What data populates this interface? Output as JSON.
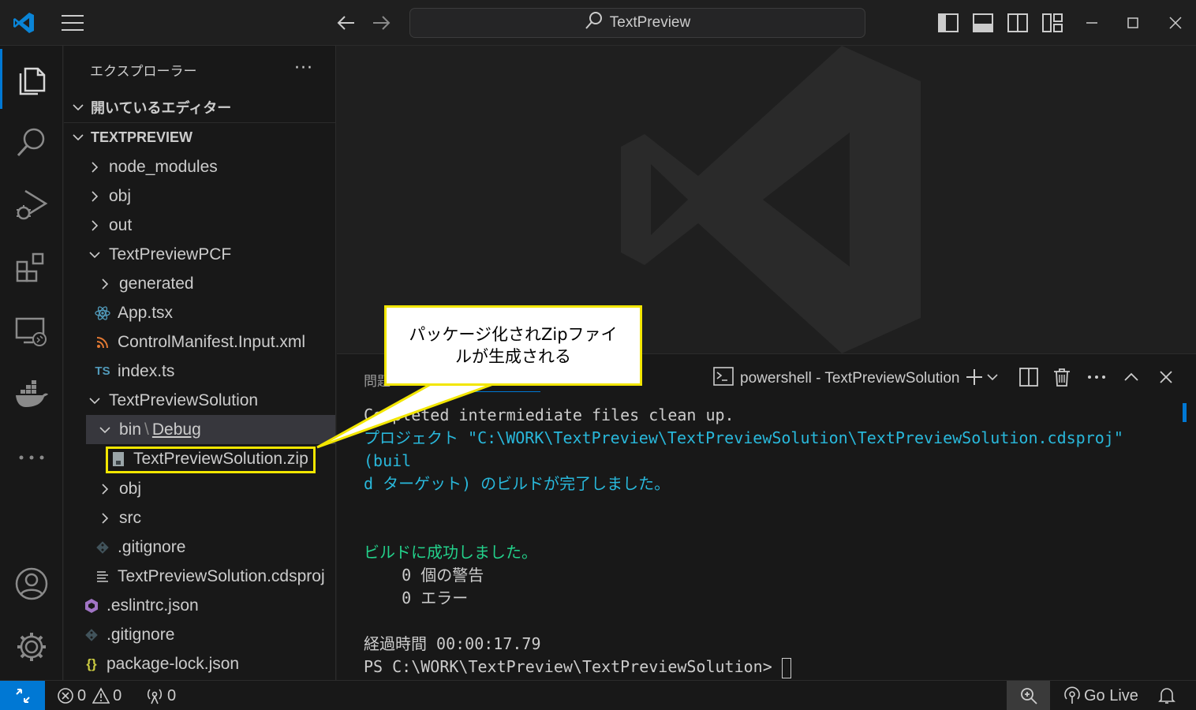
{
  "titlebar": {
    "search_text": "TextPreview"
  },
  "explorer": {
    "title": "エクスプローラー",
    "more": "···",
    "open_editors": "開いているエディター",
    "project": "TEXTPREVIEW",
    "items": [
      {
        "label": "node_modules",
        "type": "folder",
        "expanded": false
      },
      {
        "label": "obj",
        "type": "folder",
        "expanded": false
      },
      {
        "label": "out",
        "type": "folder",
        "expanded": false
      },
      {
        "label": "TextPreviewPCF",
        "type": "folder",
        "expanded": true
      },
      {
        "label": "generated",
        "type": "folder",
        "expanded": false
      },
      {
        "label": "App.tsx",
        "type": "react"
      },
      {
        "label": "ControlManifest.Input.xml",
        "type": "rss"
      },
      {
        "label": "index.ts",
        "type": "ts",
        "icon_text": "TS"
      },
      {
        "label": "TextPreviewSolution",
        "type": "folder",
        "expanded": true
      },
      {
        "label_bin": "bin",
        "label_debug": "Debug",
        "type": "folder",
        "expanded": true
      },
      {
        "label": "TextPreviewSolution.zip",
        "type": "zip"
      },
      {
        "label": "obj",
        "type": "folder",
        "expanded": false
      },
      {
        "label": "src",
        "type": "folder",
        "expanded": false
      },
      {
        "label": ".gitignore",
        "type": "git"
      },
      {
        "label": "TextPreviewSolution.cdsproj",
        "type": "lines"
      },
      {
        "label": ".eslintrc.json",
        "type": "eslint"
      },
      {
        "label": ".gitignore",
        "type": "git"
      },
      {
        "label": "package-lock.json",
        "type": "json",
        "icon_text": "{}"
      }
    ]
  },
  "panel": {
    "tab_label": "問題",
    "terminal_name": "powershell - TextPreviewSolution",
    "lines": [
      {
        "text": "Completed intermiediate files clean up.",
        "color": "#cccccc"
      },
      {
        "text": "プロジェクト \"C:\\WORK\\TextPreview\\TextPreviewSolution\\TextPreviewSolution.cdsproj\"",
        "color": "#29b8db"
      },
      {
        "text": "(buil",
        "color": "#29b8db"
      },
      {
        "text": "d ターゲット) のビルドが完了しました。",
        "color": "#29b8db"
      },
      {
        "text": "",
        "color": "#cccccc"
      },
      {
        "text": "",
        "color": "#cccccc"
      },
      {
        "text": "ビルドに成功しました。",
        "color": "#23d18b"
      },
      {
        "text": "    0 個の警告",
        "color": "#cccccc"
      },
      {
        "text": "    0 エラー",
        "color": "#cccccc"
      },
      {
        "text": "",
        "color": "#cccccc"
      },
      {
        "text": "経過時間 00:00:17.79",
        "color": "#cccccc"
      },
      {
        "text": "PS C:\\WORK\\TextPreview\\TextPreviewSolution> ",
        "color": "#cccccc"
      }
    ]
  },
  "statusbar": {
    "errors": "0",
    "warnings": "0",
    "ports": "0",
    "go_live": "Go Live"
  },
  "callout": {
    "line1": "パッケージ化されZipファイ",
    "line2": "ルが生成される"
  },
  "colors": {
    "accent": "#0078d4",
    "callout_border": "#f2e600"
  }
}
